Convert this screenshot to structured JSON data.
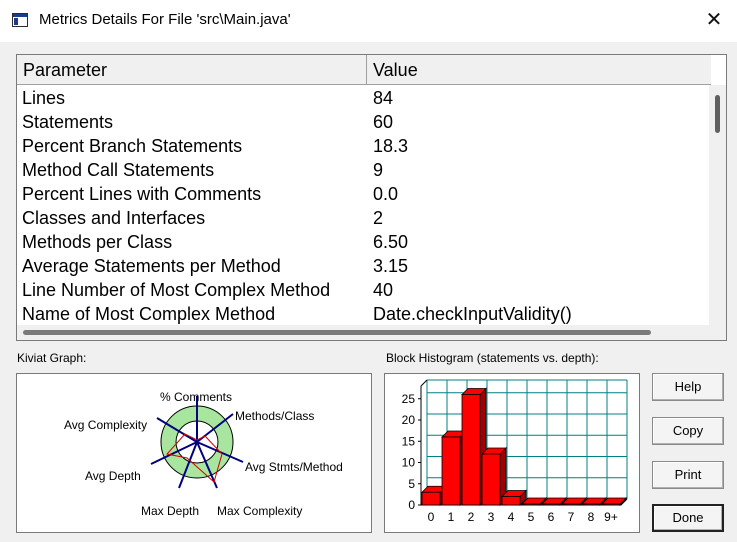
{
  "window": {
    "title": "Metrics Details For File 'src\\Main.java'",
    "close_glyph": "✕"
  },
  "table": {
    "columns": [
      "Parameter",
      "Value"
    ],
    "rows": [
      {
        "parameter": "Lines",
        "value": "84"
      },
      {
        "parameter": "Statements",
        "value": "60"
      },
      {
        "parameter": "Percent Branch Statements",
        "value": "18.3"
      },
      {
        "parameter": "Method Call Statements",
        "value": "9"
      },
      {
        "parameter": "Percent Lines with Comments",
        "value": "0.0"
      },
      {
        "parameter": "Classes and Interfaces",
        "value": "2"
      },
      {
        "parameter": "Methods per Class",
        "value": "6.50"
      },
      {
        "parameter": "Average Statements per Method",
        "value": "3.15"
      },
      {
        "parameter": "Line Number of Most Complex Method",
        "value": "40"
      },
      {
        "parameter": "Name of Most Complex Method",
        "value": "Date.checkInputValidity()"
      }
    ]
  },
  "kiviat": {
    "label": "Kiviat Graph:",
    "axes": {
      "comments": "% Comments",
      "methods_class": "Methods/Class",
      "avg_stmts": "Avg Stmts/Method",
      "max_complexity": "Max Complexity",
      "max_depth": "Max Depth",
      "avg_depth": "Avg Depth",
      "avg_complexity": "Avg Complexity"
    },
    "colors": {
      "band": "#a8e6a0",
      "axis": "#000080",
      "profile": "#d00000"
    }
  },
  "histogram": {
    "label": "Block Histogram (statements vs. depth):"
  },
  "chart_data": {
    "type": "bar",
    "title": "Block Histogram (statements vs. depth):",
    "xlabel": "",
    "ylabel": "",
    "categories": [
      "0",
      "1",
      "2",
      "3",
      "4",
      "5",
      "6",
      "7",
      "8",
      "9+"
    ],
    "values": [
      3,
      16,
      26,
      12,
      2,
      0,
      0,
      0,
      0,
      0
    ],
    "ylim": [
      0,
      28
    ],
    "yticks": [
      "0",
      "5",
      "10",
      "15",
      "20",
      "25"
    ],
    "grid": true,
    "colors": {
      "bar": "#ff0000",
      "bar_side": "#a00000",
      "grid": "#008080"
    }
  },
  "buttons": {
    "help": "Help",
    "copy": "Copy",
    "print": "Print",
    "done": "Done"
  }
}
